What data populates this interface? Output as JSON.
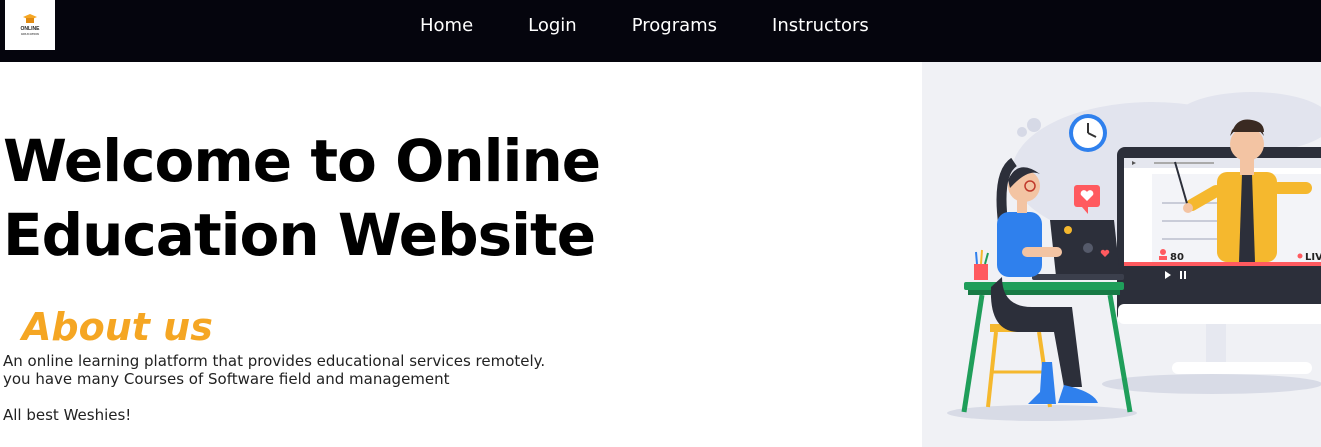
{
  "logo": {
    "title": "ONLINE",
    "subtitle": "EDUCATION"
  },
  "nav": {
    "items": [
      {
        "label": "Home"
      },
      {
        "label": "Login"
      },
      {
        "label": "Programs"
      },
      {
        "label": "Instructors"
      }
    ]
  },
  "hero": {
    "title_line1": "Welcome to Online",
    "title_line2": "Education Website"
  },
  "about": {
    "heading": "About us",
    "line1": "An online learning platform that provides educational services remotely.",
    "line2": "you have many Courses of Software field and management",
    "line3": "All best Weshies!"
  },
  "illustration": {
    "viewer_count": "80",
    "live_label": "LIVE"
  },
  "colors": {
    "navbar_bg": "#05050d",
    "accent": "#f5a623",
    "illustration_bg": "#f0f1f5"
  },
  "icons": [
    "graduation-cap-icon",
    "clock-icon",
    "heart-icon",
    "play-icon",
    "pause-icon",
    "person-icon"
  ]
}
